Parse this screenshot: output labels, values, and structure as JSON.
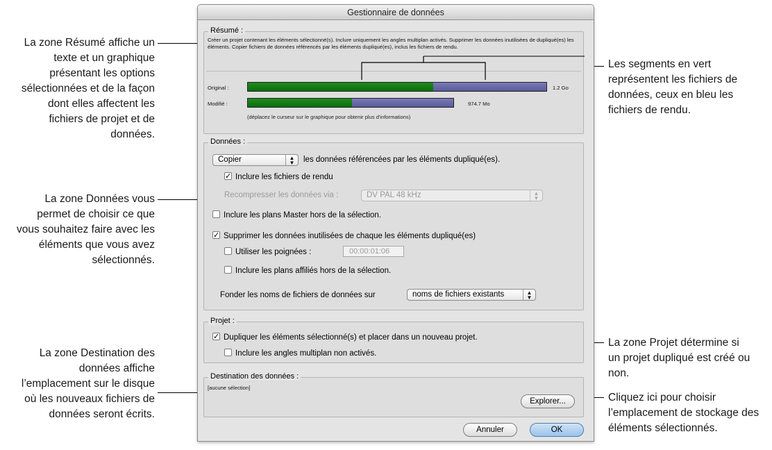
{
  "dialog": {
    "title": "Gestionnaire de données",
    "summary": {
      "legend": "Résumé :",
      "text": "Créer un projet contenant les éléments sélectionné(s). Inclure uniquement les angles multiplan activés. Supprimer les données inutilisées de dupliqué(es) les éléments. Copier fichiers de données référencés par les éléments dupliqué(es), inclus les fichiers de rendu.",
      "original_label": "Original :",
      "original_size": "1.2 Go",
      "modified_label": "Modifié :",
      "modified_size": "974.7 Mo",
      "hint": "(déplacez le curseur sur le graphique pour obtenir plus d'informations)"
    },
    "media": {
      "legend": "Données :",
      "action_popup": "Copier",
      "action_suffix": "les données référencées par les éléments dupliqué(es).",
      "include_render": "Inclure les fichiers de rendu",
      "recompress_label": "Recompresser les données via :",
      "recompress_value": "DV PAL 48 kHz",
      "include_master": "Inclure les plans Master hors de la sélection.",
      "delete_unused": "Supprimer les données inutilisées de chaque les éléments dupliqué(es)",
      "use_handles": "Utiliser les poignées :",
      "handles_value": "00:00:01:06",
      "include_affiliated": "Inclure les plans affiliés hors de la sélection.",
      "base_names_label": "Fonder les noms de fichiers de données sur",
      "base_names_value": "noms de fichiers existants"
    },
    "project": {
      "legend": "Projet :",
      "duplicate": "Dupliquer les éléments sélectionné(s) et placer dans un nouveau projet.",
      "include_inactive": "Inclure les angles multiplan non activés."
    },
    "destination": {
      "legend": "Destination des données :",
      "value": "[aucune sélection]",
      "browse_button": "Explorer..."
    },
    "cancel_button": "Annuler",
    "ok_button": "OK"
  },
  "chart_data": {
    "type": "bar",
    "categories": [
      "Original :",
      "Modifié :"
    ],
    "series": [
      {
        "values": [
          1.0,
          0.69
        ]
      },
      {
        "values": [
          0.38,
          0.34
        ]
      }
    ],
    "colors": {
      "media": "#118011",
      "render": "#6a6aaa"
    }
  },
  "callouts": {
    "summary": "La zone Résumé affiche un texte et un graphique présentant les options sélectionnées et de la façon dont elles affectent les fichiers de projet et de données.",
    "media": "La zone Données vous permet de choisir ce que vous souhaitez faire avec les éléments que vous avez sélectionnés.",
    "destination": "La zone Destination des données affiche l’emplacement sur le disque où les nouveaux fichiers de données seront écrits.",
    "segments": "Les segments en vert représentent les fichiers de données, ceux en bleu les fichiers de rendu.",
    "project": "La zone Projet détermine si un projet dupliqué est créé ou non.",
    "browse": "Cliquez ici pour choisir l’emplacement de stockage des éléments sélectionnés."
  }
}
